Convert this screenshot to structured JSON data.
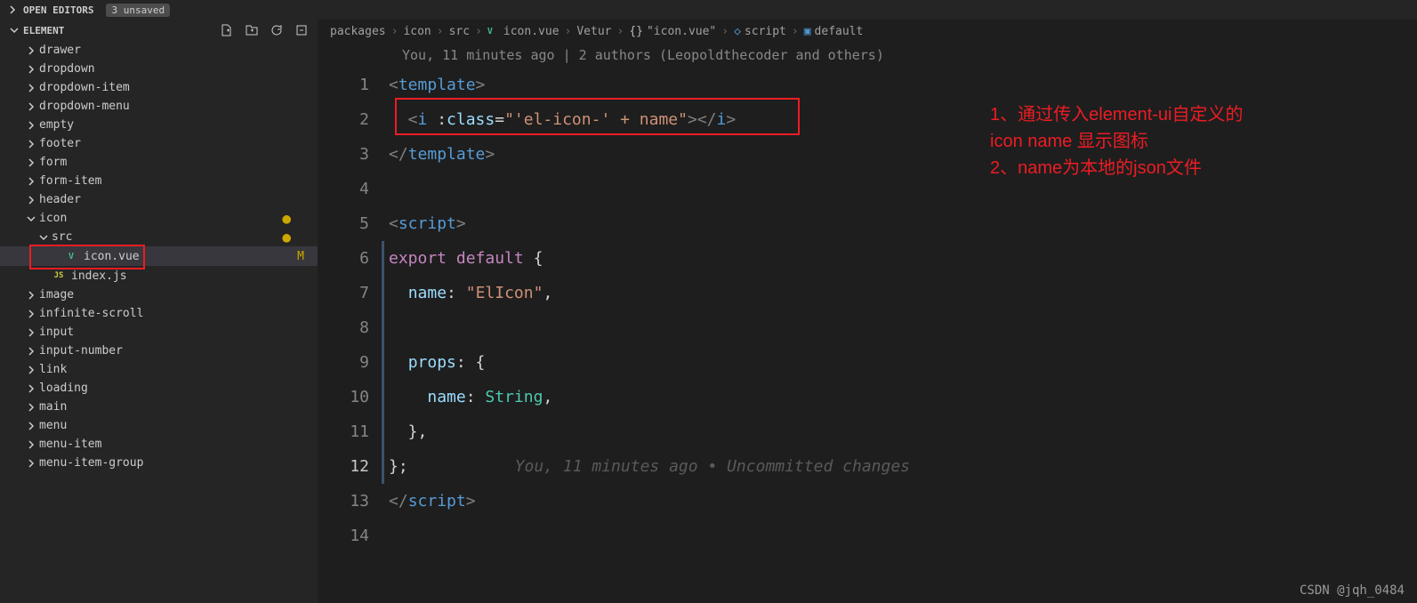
{
  "topBar": {
    "openEditorsLabel": "OPEN EDITORS",
    "unsavedBadge": "3 unsaved"
  },
  "sidebar": {
    "headerLabel": "ELEMENT",
    "items": [
      {
        "label": "drawer",
        "depth": 1,
        "chev": "right"
      },
      {
        "label": "dropdown",
        "depth": 1,
        "chev": "right"
      },
      {
        "label": "dropdown-item",
        "depth": 1,
        "chev": "right"
      },
      {
        "label": "dropdown-menu",
        "depth": 1,
        "chev": "right"
      },
      {
        "label": "empty",
        "depth": 1,
        "chev": "right"
      },
      {
        "label": "footer",
        "depth": 1,
        "chev": "right"
      },
      {
        "label": "form",
        "depth": 1,
        "chev": "right"
      },
      {
        "label": "form-item",
        "depth": 1,
        "chev": "right"
      },
      {
        "label": "header",
        "depth": 1,
        "chev": "right"
      },
      {
        "label": "icon",
        "depth": 1,
        "chev": "down",
        "modified": true
      },
      {
        "label": "src",
        "depth": 2,
        "chev": "down",
        "modified": true
      },
      {
        "label": "icon.vue",
        "depth": 3,
        "fileIcon": "vue",
        "active": true,
        "modifiedM": true,
        "redBox": true
      },
      {
        "label": "index.js",
        "depth": 2,
        "fileIcon": "js"
      },
      {
        "label": "image",
        "depth": 1,
        "chev": "right"
      },
      {
        "label": "infinite-scroll",
        "depth": 1,
        "chev": "right"
      },
      {
        "label": "input",
        "depth": 1,
        "chev": "right"
      },
      {
        "label": "input-number",
        "depth": 1,
        "chev": "right"
      },
      {
        "label": "link",
        "depth": 1,
        "chev": "right"
      },
      {
        "label": "loading",
        "depth": 1,
        "chev": "right"
      },
      {
        "label": "main",
        "depth": 1,
        "chev": "right"
      },
      {
        "label": "menu",
        "depth": 1,
        "chev": "right"
      },
      {
        "label": "menu-item",
        "depth": 1,
        "chev": "right"
      },
      {
        "label": "menu-item-group",
        "depth": 1,
        "chev": "right"
      }
    ]
  },
  "breadcrumbs": {
    "items": [
      "packages",
      "icon",
      "src",
      "icon.vue",
      "Vetur",
      "\"icon.vue\"",
      "script",
      "default"
    ]
  },
  "gitlens": {
    "banner": "You, 11 minutes ago | 2 authors (Leopoldthecoder and others)",
    "inlineHint": "You, 11 minutes ago • Uncommitted changes"
  },
  "code": {
    "lineNumbers": [
      "1",
      "2",
      "3",
      "4",
      "5",
      "6",
      "7",
      "8",
      "9",
      "10",
      "11",
      "12",
      "13",
      "14"
    ],
    "activeLine": 12,
    "lines": {
      "l1": {
        "p1": "<",
        "p2": "template",
        "p3": ">"
      },
      "l2": {
        "p1": "  <",
        "p2": "i",
        "p3": " :",
        "p4": "class",
        "p5": "=",
        "p6": "\"'el-icon-' + name\"",
        "p7": "></",
        "p8": "i",
        "p9": ">"
      },
      "l3": {
        "p1": "</",
        "p2": "template",
        "p3": ">"
      },
      "l5": {
        "p1": "<",
        "p2": "script",
        "p3": ">"
      },
      "l6": {
        "p1": "export",
        "p2": " ",
        "p3": "default",
        "p4": " {"
      },
      "l7": {
        "p1": "  ",
        "p2": "name",
        "p3": ": ",
        "p4": "\"ElIcon\"",
        "p5": ","
      },
      "l9": {
        "p1": "  ",
        "p2": "props",
        "p3": ": {"
      },
      "l10": {
        "p1": "    ",
        "p2": "name",
        "p3": ": ",
        "p4": "String",
        "p5": ","
      },
      "l11": {
        "p1": "  },"
      },
      "l12": {
        "p1": "};"
      },
      "l13": {
        "p1": "</",
        "p2": "script",
        "p3": ">"
      }
    }
  },
  "annotations": {
    "line1": "1、通过传入element-ui自定义的",
    "line2": "icon name 显示图标",
    "line3": "2、name为本地的json文件"
  },
  "watermark": "CSDN @jqh_0484"
}
